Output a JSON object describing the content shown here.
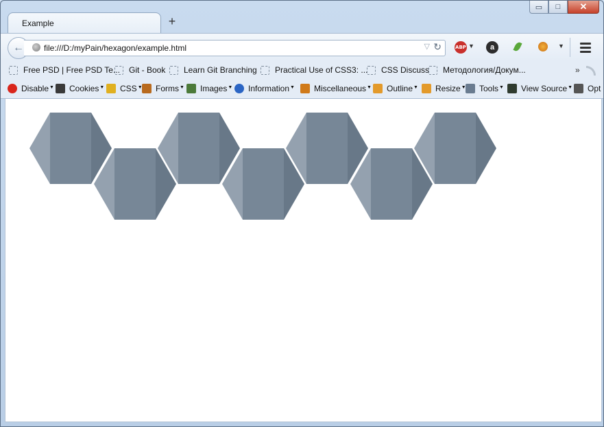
{
  "tab": {
    "title": "Example"
  },
  "window_controls": {
    "minimize": "▭",
    "maximize": "□",
    "close": "✕"
  },
  "nav": {
    "url": "file:///D:/myPain/hexagon/example.html",
    "abp_label": "ABP"
  },
  "bookmarks": [
    "Free PSD | Free PSD Te...",
    "Git - Book",
    "Learn Git Branching",
    "Practical Use of CSS3: ...",
    "CSS Discuss",
    "Методология/Докум..."
  ],
  "bookmarks_overflow": "»",
  "devtoolbar": [
    {
      "label": "Disable",
      "icon": "disable-icon",
      "color": "#d9261c"
    },
    {
      "label": "Cookies",
      "icon": "cookies-icon",
      "color": "#3a3a3a"
    },
    {
      "label": "CSS",
      "icon": "css-icon",
      "color": "#e0b020"
    },
    {
      "label": "Forms",
      "icon": "forms-icon",
      "color": "#b86a1e"
    },
    {
      "label": "Images",
      "icon": "images-icon",
      "color": "#4c7a3a"
    },
    {
      "label": "Information",
      "icon": "information-icon",
      "color": "#2b65c4"
    },
    {
      "label": "Miscellaneous",
      "icon": "miscellaneous-icon",
      "color": "#d07a1a"
    },
    {
      "label": "Outline",
      "icon": "outline-icon",
      "color": "#e39a2b"
    },
    {
      "label": "Resize",
      "icon": "resize-icon",
      "color": "#e39a2b"
    },
    {
      "label": "Tools",
      "icon": "tools-icon",
      "color": "#6a7c90"
    },
    {
      "label": "View Source",
      "icon": "view-source-icon",
      "color": "#2f3b2f"
    },
    {
      "label": "Opt",
      "icon": "options-icon",
      "color": "#555555"
    }
  ],
  "colors": {
    "hex_left": "#94a1af",
    "hex_mid": "#778797",
    "hex_right": "#687888"
  }
}
